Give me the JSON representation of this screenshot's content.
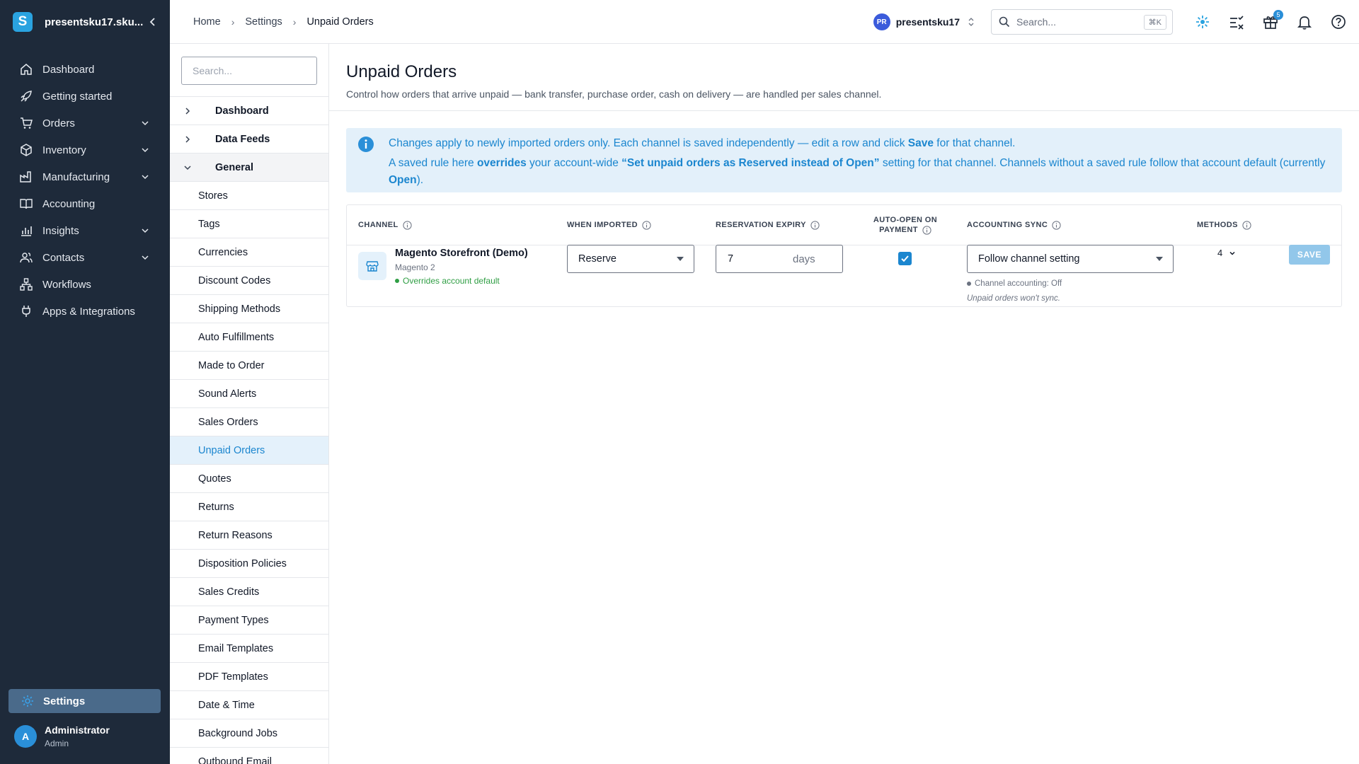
{
  "app": {
    "workspace_name": "presentsku17.sku...",
    "logo_letter": "S",
    "accent_color": "#1b86cf"
  },
  "nav": {
    "items": [
      {
        "label": "Dashboard",
        "icon": "home-icon",
        "expandable": false
      },
      {
        "label": "Getting started",
        "icon": "rocket-icon",
        "expandable": false
      },
      {
        "label": "Orders",
        "icon": "cart-icon",
        "expandable": true
      },
      {
        "label": "Inventory",
        "icon": "box-icon",
        "expandable": true
      },
      {
        "label": "Manufacturing",
        "icon": "factory-icon",
        "expandable": true
      },
      {
        "label": "Accounting",
        "icon": "book-icon",
        "expandable": false
      },
      {
        "label": "Insights",
        "icon": "chart-icon",
        "expandable": true
      },
      {
        "label": "Contacts",
        "icon": "people-icon",
        "expandable": true
      },
      {
        "label": "Workflows",
        "icon": "workflow-icon",
        "expandable": false
      },
      {
        "label": "Apps & Integrations",
        "icon": "plug-icon",
        "expandable": false
      }
    ],
    "settings_label": "Settings",
    "user": {
      "initial": "A",
      "name": "Administrator",
      "role": "Admin"
    }
  },
  "topbar": {
    "breadcrumbs": [
      "Home",
      "Settings",
      "Unpaid Orders"
    ],
    "account_initials": "PR",
    "account_name": "presentsku17",
    "search_placeholder": "Search...",
    "search_shortcut": "⌘K",
    "gift_badge": "5"
  },
  "subnav": {
    "search_placeholder": "Search...",
    "groups": [
      {
        "label": "Dashboard",
        "expanded": false
      },
      {
        "label": "Data Feeds",
        "expanded": false
      },
      {
        "label": "General",
        "expanded": true
      }
    ],
    "items": [
      "Stores",
      "Tags",
      "Currencies",
      "Discount Codes",
      "Shipping Methods",
      "Auto Fulfillments",
      "Made to Order",
      "Sound Alerts",
      "Sales Orders",
      "Unpaid Orders",
      "Quotes",
      "Returns",
      "Return Reasons",
      "Disposition Policies",
      "Sales Credits",
      "Payment Types",
      "Email Templates",
      "PDF Templates",
      "Date & Time",
      "Background Jobs",
      "Outbound Email"
    ],
    "active_item": "Unpaid Orders"
  },
  "page": {
    "title": "Unpaid Orders",
    "subtitle": "Control how orders that arrive unpaid — bank transfer, purchase order, cash on delivery — are handled per sales channel."
  },
  "info": {
    "l1_a": "Changes apply to newly imported orders only. Each channel is saved independently — edit a row and click ",
    "l1_b": "Save",
    "l1_c": " for that channel.",
    "l2_a": "A saved rule here ",
    "l2_b": "overrides",
    "l2_c": " your account-wide ",
    "l2_d": "“Set unpaid orders as Reserved instead of Open”",
    "l2_e": " setting for that channel. Channels without a saved rule follow that account default (currently ",
    "l2_f": "Open",
    "l2_g": ")."
  },
  "table": {
    "headers": {
      "channel": "Channel",
      "when_imported": "When imported",
      "reservation_expiry": "Reservation expiry",
      "auto_open_l1": "Auto-open on",
      "auto_open_l2": "payment",
      "accounting_sync": "Accounting sync",
      "methods": "Methods"
    },
    "row": {
      "channel_name": "Magento Storefront (Demo)",
      "channel_type": "Magento 2",
      "override_status": "Overrides account default",
      "when_imported": "Reserve",
      "expiry_value": "7",
      "expiry_unit": "days",
      "auto_open_checked": true,
      "accounting_sync": "Follow channel setting",
      "accounting_note": "Channel accounting: Off",
      "accounting_warning": "Unpaid orders won't sync.",
      "methods_count": "4",
      "save_label": "SAVE"
    }
  }
}
